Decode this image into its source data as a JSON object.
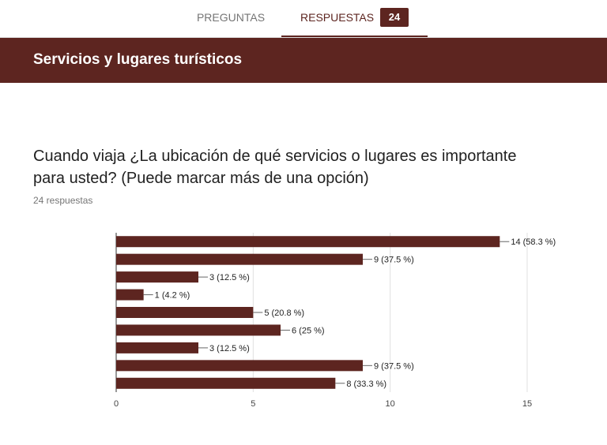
{
  "tabs": {
    "preguntas": "PREGUNTAS",
    "respuestas": "RESPUESTAS",
    "respuestas_count": "24"
  },
  "section": {
    "title": "Servicios y lugares turísticos"
  },
  "question": {
    "text": "Cuando viaja ¿La ubicación de qué servicios o lugares es importante para usted? (Puede marcar más de una opción)",
    "response_count": "24 respuestas"
  },
  "colors": {
    "brand": "#5d2520",
    "tab_inactive": "#757575"
  },
  "chart_data": {
    "type": "bar",
    "orientation": "horizontal",
    "categories": [
      "",
      "",
      "",
      "",
      "",
      "",
      "",
      "",
      ""
    ],
    "values": [
      14,
      9,
      3,
      1,
      5,
      6,
      3,
      9,
      8
    ],
    "data_labels": [
      "14 (58.3 %)",
      "9 (37.5 %)",
      "3 (12.5 %)",
      "1 (4.2 %)",
      "5 (20.8 %)",
      "6 (25 %)",
      "3 (12.5 %)",
      "9 (37.5 %)",
      "8 (33.3 %)"
    ],
    "xticks": [
      0,
      5,
      10,
      15
    ],
    "xlim": [
      0,
      15
    ],
    "grid": true,
    "color": "#5d2520"
  }
}
